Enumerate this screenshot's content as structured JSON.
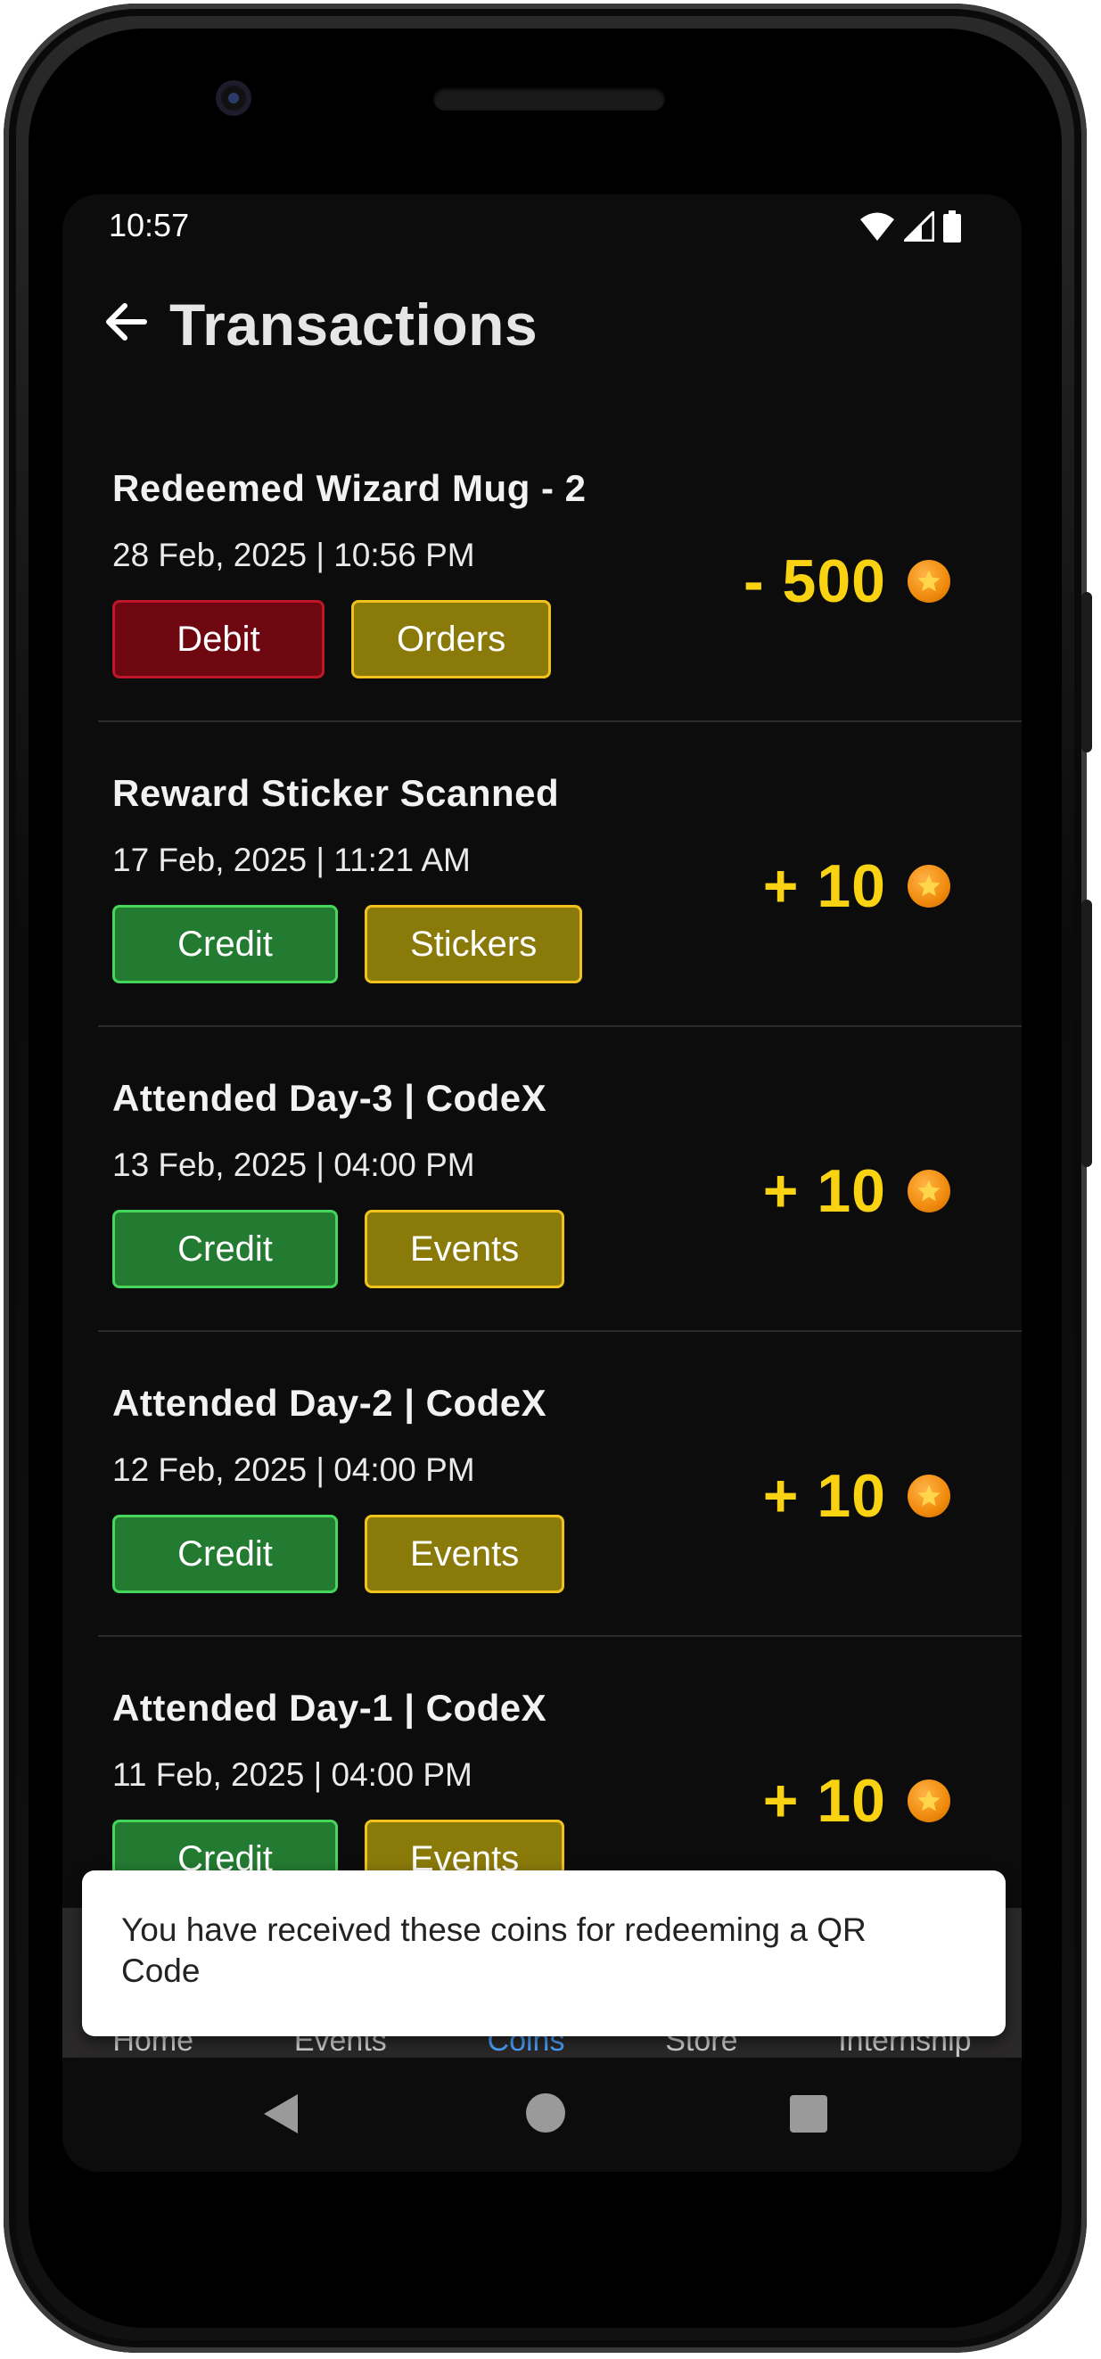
{
  "status_bar": {
    "time": "10:57"
  },
  "header": {
    "title": "Transactions"
  },
  "transactions": [
    {
      "title": "Redeemed Wizard Mug - 2",
      "date": "28 Feb, 2025 | 10:56 PM",
      "type": "Debit",
      "category": "Orders",
      "amount": "- 500"
    },
    {
      "title": "Reward Sticker Scanned",
      "date": "17 Feb, 2025 | 11:21 AM",
      "type": "Credit",
      "category": "Stickers",
      "amount": "+ 10"
    },
    {
      "title": "Attended Day-3 | CodeX",
      "date": "13 Feb, 2025 | 04:00 PM",
      "type": "Credit",
      "category": "Events",
      "amount": "+ 10"
    },
    {
      "title": "Attended Day-2 | CodeX",
      "date": "12 Feb, 2025 | 04:00 PM",
      "type": "Credit",
      "category": "Events",
      "amount": "+ 10"
    },
    {
      "title": "Attended Day-1 | CodeX",
      "date": "11 Feb, 2025 | 04:00 PM",
      "type": "Credit",
      "category": "Events",
      "amount": "+ 10"
    }
  ],
  "bottom_nav": {
    "items": [
      "Home",
      "Events",
      "Coins",
      "Store",
      "Internship"
    ],
    "active_index": 2
  },
  "snackbar": {
    "message": "You have received these coins for redeeming a QR Code"
  },
  "icons": {
    "back": "arrow-left-icon",
    "coin": "star-coin-icon",
    "wifi": "wifi-icon",
    "signal": "signal-icon",
    "battery": "battery-icon"
  },
  "colors": {
    "accent_amount": "#f9d312",
    "debit": "#6e0710",
    "credit": "#237a31",
    "category": "#8a7a0a",
    "background": "#0c0c0c"
  }
}
